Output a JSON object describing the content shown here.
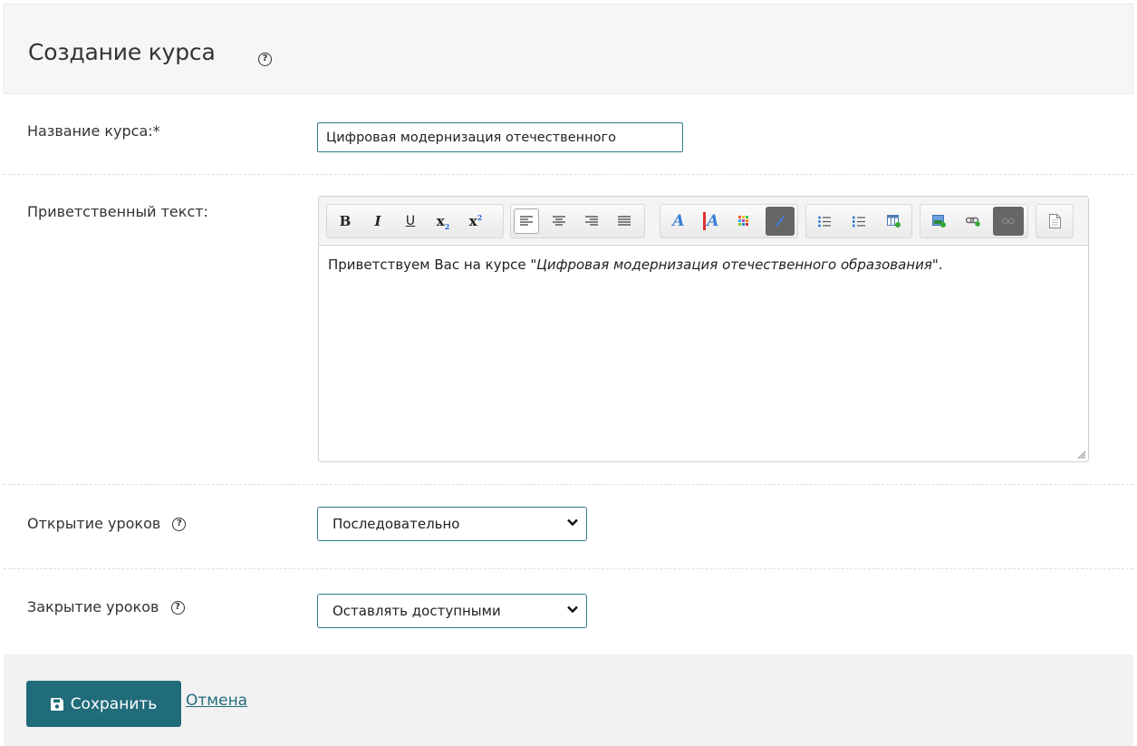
{
  "header": {
    "title": "Создание курса"
  },
  "form": {
    "course_name": {
      "label": "Название курса:*",
      "value": "Цифровая модернизация отечественного"
    },
    "welcome_text": {
      "label": "Приветственный текст:",
      "content_prefix": "Приветствуем Вас на курсе \"",
      "content_italic": "Цифровая модернизация отечественного образования",
      "content_suffix": "\"."
    },
    "lesson_opening": {
      "label": "Открытие уроков",
      "selected": "Последовательно"
    },
    "lesson_closing": {
      "label": "Закрытие уроков",
      "selected": "Оставлять доступными"
    }
  },
  "toolbar": {
    "buttons": [
      "bold",
      "italic",
      "underline",
      "subscript",
      "superscript",
      "align-left",
      "align-center",
      "align-right",
      "align-justify",
      "font-color",
      "background-color",
      "color-grid",
      "color-picker",
      "bullet-list",
      "numbered-list",
      "table",
      "image",
      "link",
      "unlink",
      "html-source"
    ],
    "bold_label": "B",
    "italic_label": "I",
    "underline_label": "U",
    "sub_label": "x",
    "sup_label": "x"
  },
  "footer": {
    "save_label": "Сохранить",
    "cancel_label": "Отмена"
  },
  "colors": {
    "accent": "#216c7a",
    "border": "#2e7a87"
  }
}
